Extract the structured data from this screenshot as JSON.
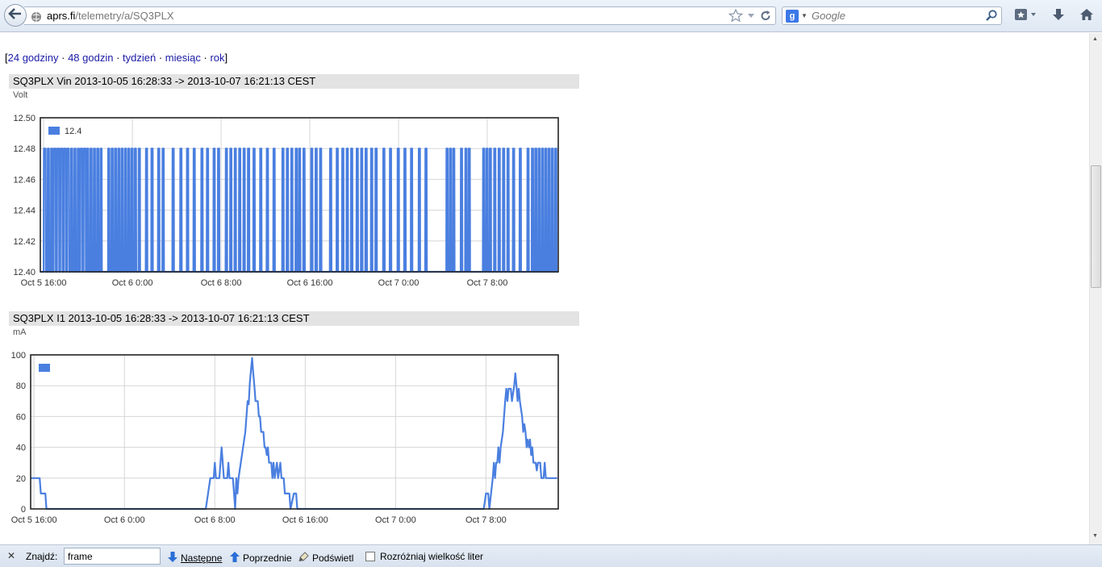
{
  "browser": {
    "url_domain": "aprs.fi",
    "url_path": "/telemetry/a/SQ3PLX",
    "search_placeholder": "Google",
    "search_engine_badge": "g"
  },
  "page": {
    "range_open": "[",
    "range_close": "]",
    "range_separator": " · ",
    "range_links": [
      "24 godziny",
      "48 godzin",
      "tydzień",
      "miesiąc",
      "rok"
    ]
  },
  "charts": [
    {
      "title": "SQ3PLX Vin 2013-10-05 16:28:33 -> 2013-10-07 16:21:13 CEST",
      "unit": "Volt",
      "legend": "12.4"
    },
    {
      "title": "SQ3PLX I1 2013-10-05 16:28:33 -> 2013-10-07 16:21:13 CEST",
      "unit": "mA",
      "legend": ""
    }
  ],
  "chart_data": [
    {
      "type": "line",
      "title": "SQ3PLX Vin 2013-10-05 16:28:33 -> 2013-10-07 16:21:13 CEST",
      "ylabel": "Volt",
      "ylim": [
        12.4,
        12.5
      ],
      "yticks": [
        "12.50",
        "12.48",
        "12.46",
        "12.44",
        "12.42",
        "12.40"
      ],
      "xticks": [
        "Oct 5 16:00",
        "Oct 6 0:00",
        "Oct 6 8:00",
        "Oct 6 16:00",
        "Oct 7 0:00",
        "Oct 7 8:00"
      ],
      "x_range_hours": [
        15.7,
        62.4
      ],
      "xtick_hours": [
        16,
        24,
        32,
        40,
        48,
        56
      ],
      "grid": true,
      "legend_position": "top-left",
      "series": [
        {
          "name": "12.4",
          "color": "#4a7fe0",
          "low": 12.4,
          "high": 12.48,
          "high_intervals_hours": [
            [
              16.0,
              16.2
            ],
            [
              16.35,
              16.5
            ],
            [
              16.65,
              16.8
            ],
            [
              16.9,
              17.1
            ],
            [
              17.2,
              17.4
            ],
            [
              17.5,
              17.7
            ],
            [
              17.8,
              18.0
            ],
            [
              18.1,
              18.3
            ],
            [
              18.45,
              18.6
            ],
            [
              18.75,
              18.9
            ],
            [
              19.05,
              19.2
            ],
            [
              19.3,
              19.5
            ],
            [
              19.6,
              19.8
            ],
            [
              19.9,
              20.05
            ],
            [
              20.2,
              20.35
            ],
            [
              20.5,
              20.65
            ],
            [
              20.8,
              20.95
            ],
            [
              21.1,
              21.25
            ],
            [
              21.8,
              21.95
            ],
            [
              22.1,
              22.25
            ],
            [
              22.4,
              22.55
            ],
            [
              22.7,
              22.85
            ],
            [
              23.0,
              23.15
            ],
            [
              23.3,
              23.45
            ],
            [
              23.6,
              23.75
            ],
            [
              23.9,
              24.05
            ],
            [
              24.2,
              24.35
            ],
            [
              24.55,
              24.7
            ],
            [
              25.2,
              25.35
            ],
            [
              25.7,
              25.85
            ],
            [
              26.3,
              26.45
            ],
            [
              26.7,
              26.85
            ],
            [
              27.6,
              27.75
            ],
            [
              28.3,
              28.45
            ],
            [
              28.9,
              29.05
            ],
            [
              29.5,
              29.65
            ],
            [
              30.2,
              30.35
            ],
            [
              30.7,
              30.85
            ],
            [
              31.3,
              31.45
            ],
            [
              31.7,
              31.85
            ],
            [
              32.4,
              32.55
            ],
            [
              32.8,
              32.95
            ],
            [
              33.2,
              33.35
            ],
            [
              33.6,
              33.75
            ],
            [
              34.0,
              34.15
            ],
            [
              34.4,
              34.55
            ],
            [
              34.9,
              35.05
            ],
            [
              35.5,
              35.65
            ],
            [
              36.1,
              36.25
            ],
            [
              36.7,
              36.85
            ],
            [
              37.5,
              37.65
            ],
            [
              37.9,
              38.05
            ],
            [
              38.3,
              38.45
            ],
            [
              38.7,
              38.85
            ],
            [
              39.0,
              39.15
            ],
            [
              39.4,
              39.55
            ],
            [
              40.1,
              40.25
            ],
            [
              40.5,
              40.65
            ],
            [
              40.9,
              41.05
            ],
            [
              41.8,
              41.95
            ],
            [
              42.4,
              42.55
            ],
            [
              42.9,
              43.05
            ],
            [
              43.3,
              43.45
            ],
            [
              43.7,
              43.85
            ],
            [
              44.2,
              44.35
            ],
            [
              44.6,
              44.75
            ],
            [
              45.0,
              45.15
            ],
            [
              45.5,
              45.65
            ],
            [
              45.9,
              46.05
            ],
            [
              46.6,
              46.75
            ],
            [
              47.2,
              47.35
            ],
            [
              47.9,
              48.05
            ],
            [
              48.5,
              48.65
            ],
            [
              49.1,
              49.25
            ],
            [
              49.8,
              49.95
            ],
            [
              50.4,
              50.55
            ],
            [
              52.3,
              52.45
            ],
            [
              52.6,
              52.75
            ],
            [
              52.9,
              53.05
            ],
            [
              53.6,
              53.75
            ],
            [
              54.0,
              54.15
            ],
            [
              54.3,
              54.45
            ],
            [
              55.6,
              55.75
            ],
            [
              55.9,
              56.05
            ],
            [
              56.2,
              56.35
            ],
            [
              56.6,
              56.75
            ],
            [
              57.0,
              57.15
            ],
            [
              57.4,
              57.55
            ],
            [
              57.8,
              57.95
            ],
            [
              58.3,
              58.45
            ],
            [
              58.9,
              59.05
            ],
            [
              59.6,
              59.75
            ],
            [
              60.0,
              60.15
            ],
            [
              60.3,
              60.45
            ],
            [
              60.6,
              60.75
            ],
            [
              60.9,
              61.05
            ],
            [
              61.2,
              61.35
            ],
            [
              61.5,
              61.65
            ],
            [
              61.8,
              61.95
            ],
            [
              62.1,
              62.25
            ]
          ]
        }
      ]
    },
    {
      "type": "line",
      "title": "SQ3PLX I1 2013-10-05 16:28:33 -> 2013-10-07 16:21:13 CEST",
      "ylabel": "mA",
      "ylim": [
        0,
        100
      ],
      "yticks": [
        "100",
        "80",
        "60",
        "40",
        "20",
        "0"
      ],
      "xticks": [
        "Oct 5 16:00",
        "Oct 6 0:00",
        "Oct 6 8:00",
        "Oct 6 16:00",
        "Oct 7 0:00",
        "Oct 7 8:00"
      ],
      "x_range_hours": [
        15.7,
        62.4
      ],
      "xtick_hours": [
        16,
        24,
        32,
        40,
        48,
        56
      ],
      "grid": true,
      "legend_position": "top-left",
      "series": [
        {
          "name": "",
          "color": "#4a7fe0",
          "points_hours": [
            [
              15.7,
              20
            ],
            [
              16.5,
              20
            ],
            [
              16.6,
              10
            ],
            [
              17.0,
              10
            ],
            [
              17.1,
              0
            ],
            [
              31.2,
              0
            ],
            [
              31.4,
              10
            ],
            [
              31.6,
              20
            ],
            [
              31.9,
              20
            ],
            [
              32.0,
              30
            ],
            [
              32.1,
              20
            ],
            [
              32.4,
              20
            ],
            [
              32.6,
              40
            ],
            [
              32.7,
              30
            ],
            [
              32.8,
              20
            ],
            [
              33.1,
              20
            ],
            [
              33.2,
              30
            ],
            [
              33.3,
              20
            ],
            [
              33.6,
              20
            ],
            [
              33.7,
              10
            ],
            [
              33.8,
              0
            ],
            [
              33.9,
              20
            ],
            [
              34.0,
              10
            ],
            [
              34.1,
              20
            ],
            [
              34.3,
              30
            ],
            [
              34.5,
              40
            ],
            [
              34.7,
              50
            ],
            [
              34.8,
              60
            ],
            [
              34.9,
              70
            ],
            [
              35.0,
              68
            ],
            [
              35.1,
              82
            ],
            [
              35.2,
              90
            ],
            [
              35.3,
              98
            ],
            [
              35.4,
              88
            ],
            [
              35.5,
              80
            ],
            [
              35.6,
              70
            ],
            [
              35.8,
              70
            ],
            [
              35.9,
              60
            ],
            [
              36.0,
              60
            ],
            [
              36.1,
              50
            ],
            [
              36.3,
              50
            ],
            [
              36.4,
              40
            ],
            [
              36.5,
              40
            ],
            [
              36.6,
              35
            ],
            [
              36.7,
              40
            ],
            [
              36.8,
              30
            ],
            [
              37.0,
              30
            ],
            [
              37.1,
              20
            ],
            [
              37.2,
              30
            ],
            [
              37.3,
              20
            ],
            [
              37.5,
              30
            ],
            [
              37.6,
              20
            ],
            [
              37.8,
              30
            ],
            [
              37.9,
              20
            ],
            [
              38.1,
              20
            ],
            [
              38.2,
              10
            ],
            [
              38.6,
              10
            ],
            [
              38.7,
              0
            ],
            [
              39.0,
              10
            ],
            [
              39.2,
              10
            ],
            [
              39.3,
              0
            ],
            [
              55.8,
              0
            ],
            [
              56.0,
              10
            ],
            [
              56.2,
              10
            ],
            [
              56.3,
              0
            ],
            [
              56.6,
              20
            ],
            [
              56.7,
              30
            ],
            [
              56.8,
              20
            ],
            [
              56.9,
              30
            ],
            [
              57.0,
              30
            ],
            [
              57.1,
              40
            ],
            [
              57.2,
              30
            ],
            [
              57.3,
              40
            ],
            [
              57.5,
              50
            ],
            [
              57.6,
              60
            ],
            [
              57.7,
              70
            ],
            [
              57.8,
              78
            ],
            [
              57.9,
              70
            ],
            [
              58.0,
              78
            ],
            [
              58.2,
              78
            ],
            [
              58.3,
              70
            ],
            [
              58.5,
              80
            ],
            [
              58.6,
              88
            ],
            [
              58.7,
              80
            ],
            [
              58.8,
              70
            ],
            [
              58.9,
              78
            ],
            [
              59.0,
              70
            ],
            [
              59.2,
              60
            ],
            [
              59.3,
              50
            ],
            [
              59.4,
              55
            ],
            [
              59.5,
              50
            ],
            [
              59.6,
              40
            ],
            [
              59.7,
              45
            ],
            [
              59.8,
              40
            ],
            [
              59.9,
              45
            ],
            [
              60.0,
              35
            ],
            [
              60.1,
              40
            ],
            [
              60.2,
              30
            ],
            [
              60.4,
              30
            ],
            [
              60.5,
              25
            ],
            [
              60.6,
              30
            ],
            [
              60.8,
              30
            ],
            [
              60.9,
              20
            ],
            [
              61.1,
              20
            ],
            [
              61.2,
              30
            ],
            [
              61.3,
              20
            ],
            [
              62.3,
              20
            ]
          ]
        }
      ]
    }
  ],
  "findbar": {
    "label": "Znajdź:",
    "query": "frame",
    "next": "Następne",
    "prev": "Poprzednie",
    "highlight": "Podświetl",
    "match_case": "Rozróżniaj wielkość liter"
  },
  "colors": {
    "series": "#4a7fe0",
    "link": "#1a1aa6",
    "title_bar": "#e3e3e3"
  }
}
